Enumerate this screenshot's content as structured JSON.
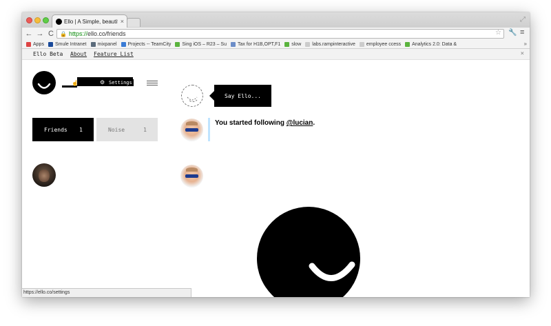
{
  "browser": {
    "tab_title": "Ello | A Simple, beautiful &",
    "tab_close": "×",
    "url_scheme": "https://",
    "url_rest": "ello.co/friends",
    "status_url": "https://ello.co/settings",
    "nav": {
      "back": "←",
      "forward": "→",
      "reload": "C"
    },
    "bookmarks": [
      {
        "label": "Apps",
        "color": "#d44"
      },
      {
        "label": "Smule Intranet",
        "color": "#1a4a9a"
      },
      {
        "label": "mixpanel",
        "color": "#5b6b7b"
      },
      {
        "label": "Projects -- TeamCity",
        "color": "#3a7bd5"
      },
      {
        "label": "Sing iOS – R23 – Su",
        "color": "#5ab33d"
      },
      {
        "label": "Tax for H1B,OPT,F1",
        "color": "#6c8dc8"
      },
      {
        "label": "slow",
        "color": "#5ab33d"
      },
      {
        "label": "labs.rampinteractive",
        "color": "#cccccc"
      },
      {
        "label": "employee ccess",
        "color": "#cccccc"
      },
      {
        "label": "Analytics 2.0: Data &",
        "color": "#5ab33d"
      }
    ]
  },
  "site_nav": {
    "brand": "Ello Beta",
    "about": "About",
    "feature_list": "Feature List",
    "close": "×"
  },
  "profile": {
    "settings_label": "Settings"
  },
  "streams": {
    "friends": {
      "label": "Friends",
      "count": "1"
    },
    "noise": {
      "label": "Noise",
      "count": "1"
    }
  },
  "composer": {
    "say_label": "Say Ello..."
  },
  "notification": {
    "prefix": "You started following ",
    "mention": "@lucian",
    "suffix": "."
  },
  "colors": {
    "brand_black": "#000000",
    "notification_accent": "#bfe4ff"
  }
}
